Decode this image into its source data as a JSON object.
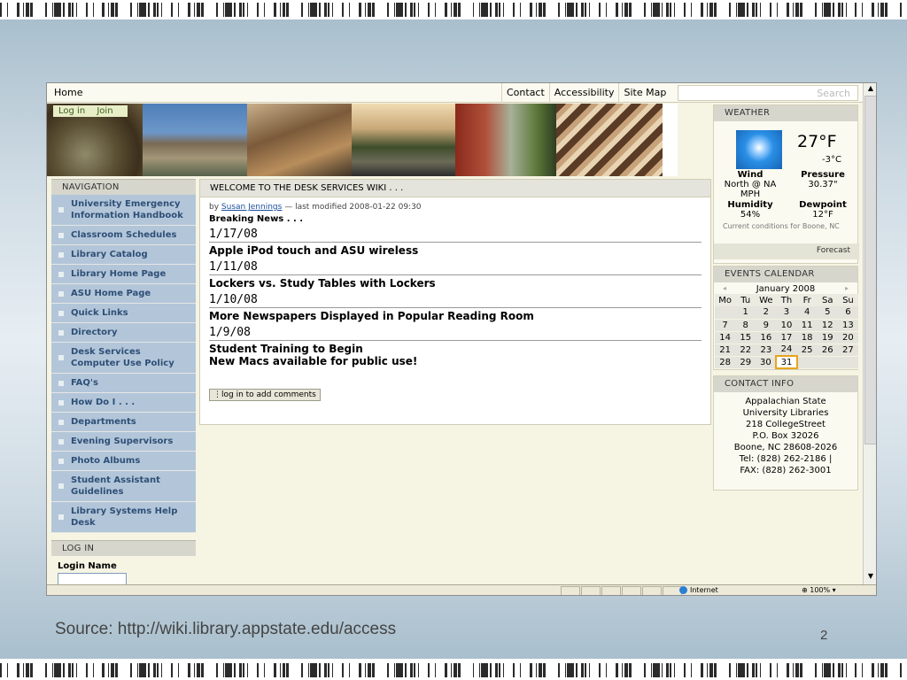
{
  "topbar": {
    "home": "Home",
    "links": [
      "Contact",
      "Accessibility",
      "Site Map"
    ],
    "search_placeholder": "Search"
  },
  "banner": {
    "login": "Log in",
    "join": "Join"
  },
  "navigation": {
    "title": "NAVIGATION",
    "items": [
      "University Emergency Information Handbook",
      "Classroom Schedules",
      "Library Catalog",
      "Library Home Page",
      "ASU Home Page",
      "Quick Links",
      "Directory",
      "Desk Services Computer Use Policy",
      "FAQ's",
      "How Do I . . .",
      "Departments",
      "Evening Supervisors",
      "Photo Albums",
      "Student Assistant Guidelines",
      "Library Systems Help Desk"
    ]
  },
  "login_box": {
    "title": "LOG IN",
    "login_name_label": "Login Name"
  },
  "content": {
    "title": "WELCOME TO THE DESK SERVICES WIKI . . .",
    "byline_prefix": "by",
    "author": "Susan Jennings",
    "byline_suffix": "— last modified 2008-01-22 09:30",
    "breaking": "Breaking News . . .",
    "entries": [
      {
        "date": "1/17/08",
        "title": "Apple iPod touch and ASU wireless"
      },
      {
        "date": "1/11/08",
        "title": "Lockers vs. Study Tables with Lockers"
      },
      {
        "date": "1/10/08",
        "title": "More Newspapers Displayed in Popular Reading Room"
      },
      {
        "date": "1/9/08",
        "title": "Student Training to Begin"
      }
    ],
    "last_item": "New Macs available for public use!",
    "comment_button": "log in to add comments"
  },
  "weather": {
    "title": "WEATHER",
    "temp_f": "27°F",
    "temp_c": "-3°C",
    "wind_label": "Wind",
    "wind_value": "North @ NA MPH",
    "pressure_label": "Pressure",
    "pressure_value": "30.37\"",
    "humidity_label": "Humidity",
    "humidity_value": "54%",
    "dewpoint_label": "Dewpoint",
    "dewpoint_value": "12°F",
    "current_conditions": "Current conditions for Boone, NC",
    "forecast": "Forecast"
  },
  "calendar": {
    "title": "EVENTS CALENDAR",
    "month": "January 2008",
    "weekdays": [
      "Mo",
      "Tu",
      "We",
      "Th",
      "Fr",
      "Sa",
      "Su"
    ],
    "weeks": [
      [
        "",
        "1",
        "2",
        "3",
        "4",
        "5",
        "6"
      ],
      [
        "7",
        "8",
        "9",
        "10",
        "11",
        "12",
        "13"
      ],
      [
        "14",
        "15",
        "16",
        "17",
        "18",
        "19",
        "20"
      ],
      [
        "21",
        "22",
        "23",
        "24",
        "25",
        "26",
        "27"
      ],
      [
        "28",
        "29",
        "30",
        "31",
        "",
        "",
        ""
      ]
    ],
    "today": "31"
  },
  "contact": {
    "title": "CONTACT INFO",
    "lines": [
      "Appalachian State",
      "University Libraries",
      "218 CollegeStreet",
      "P.O. Box 32026",
      "Boone, NC 28608-2026",
      "Tel: (828) 262-2186 |",
      "FAX: (828) 262-3001"
    ]
  },
  "statusbar": {
    "zone": "Internet",
    "zoom": "100%"
  },
  "slide": {
    "caption": "Source: http://wiki.library.appstate.edu/access",
    "page_number": "2"
  }
}
